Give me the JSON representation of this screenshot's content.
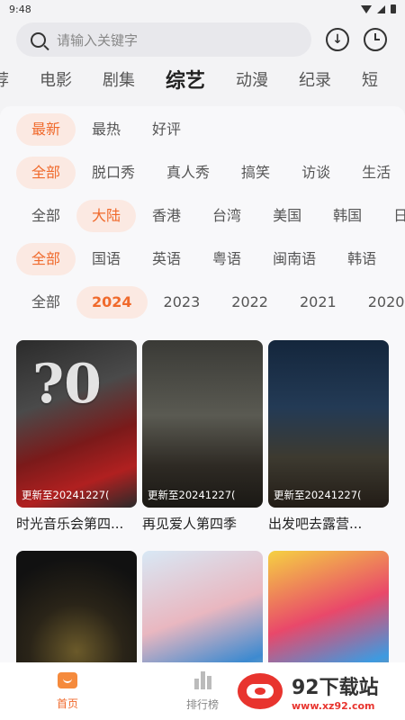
{
  "status": {
    "time": "9:48"
  },
  "search": {
    "placeholder": "请输入关键字"
  },
  "categories": [
    "荐",
    "电影",
    "剧集",
    "综艺",
    "动漫",
    "纪录",
    "短"
  ],
  "filters": {
    "sort": [
      "最新",
      "最热",
      "好评"
    ],
    "genre": [
      "全部",
      "脱口秀",
      "真人秀",
      "搞笑",
      "访谈",
      "生活"
    ],
    "region": [
      "全部",
      "大陆",
      "香港",
      "台湾",
      "美国",
      "韩国",
      "日"
    ],
    "language": [
      "全部",
      "国语",
      "英语",
      "粤语",
      "闽南语",
      "韩语"
    ],
    "year": [
      "全部",
      "2024",
      "2023",
      "2022",
      "2021",
      "2020"
    ]
  },
  "shows": [
    {
      "title": "时光音乐会第四...",
      "update": "更新至20241227("
    },
    {
      "title": "再见爱人第四季",
      "update": "更新至20241227("
    },
    {
      "title": "出发吧去露营...",
      "update": "更新至20241227("
    },
    {
      "title": "",
      "update": ""
    },
    {
      "title": "",
      "update": ""
    },
    {
      "title": "",
      "update": ""
    }
  ],
  "bottom_nav": [
    "首页",
    "排行榜"
  ],
  "watermark": {
    "name": "92下载站",
    "url": "www.xz92.com"
  },
  "colors": {
    "accent": "#f06a2c",
    "chip_bg": "#fbe9e2"
  }
}
